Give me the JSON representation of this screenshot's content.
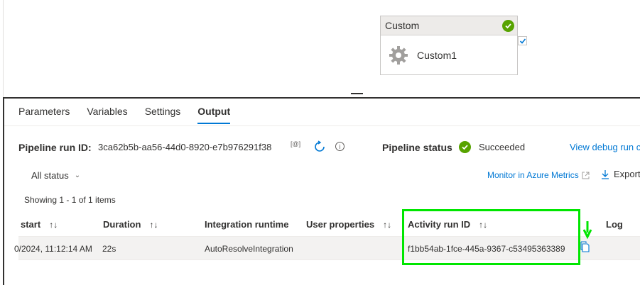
{
  "canvas": {
    "activity": {
      "type_label": "Custom",
      "name": "Custom1",
      "status_color": "#57a300"
    }
  },
  "tabs": [
    {
      "label": "Parameters",
      "active": false
    },
    {
      "label": "Variables",
      "active": false
    },
    {
      "label": "Settings",
      "active": false
    },
    {
      "label": "Output",
      "active": true
    }
  ],
  "run": {
    "pipeline_run_label": "Pipeline run ID:",
    "pipeline_run_id": "3ca62b5b-aa56-44d0-8920-e7b976291f38",
    "copy_glyph": "[@]",
    "info_glyph": "i",
    "status_label": "Pipeline status",
    "status_value": "Succeeded",
    "debug_link": "View debug run c"
  },
  "toolbar": {
    "filter_label": "All status",
    "monitor_link": "Monitor in Azure Metrics",
    "export_label": "Export"
  },
  "summary": "Showing 1 - 1 of 1 items",
  "table": {
    "columns": [
      "start",
      "Duration",
      "Integration runtime",
      "User properties",
      "Activity run ID",
      "Log"
    ],
    "rows": [
      {
        "start": "0/2024, 11:12:14 AM",
        "duration": "22s",
        "integration_runtime": "AutoResolveIntegration",
        "user_properties": "",
        "activity_run_id": "f1bb54ab-1fce-445a-9367-c53495363389"
      }
    ]
  },
  "colors": {
    "accent": "#0078d4",
    "success": "#57a300",
    "highlight": "#00e600"
  }
}
